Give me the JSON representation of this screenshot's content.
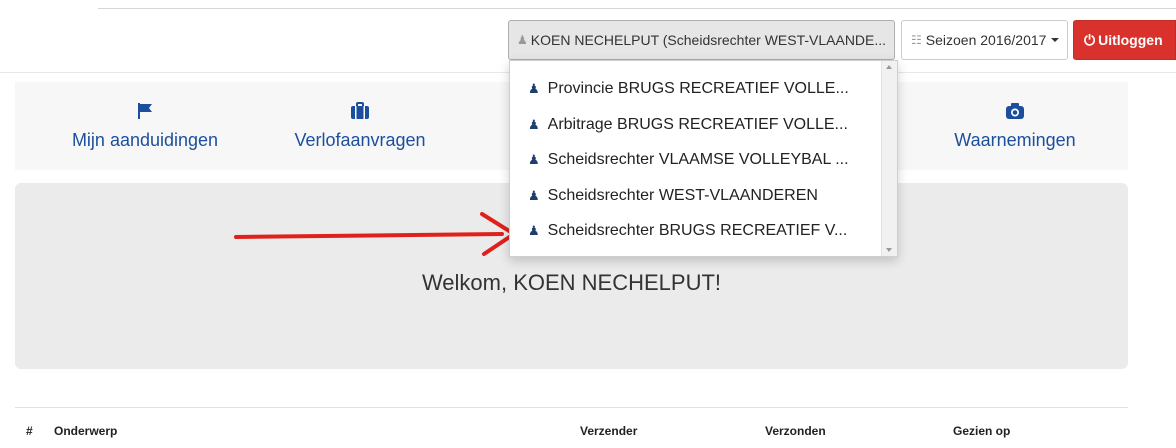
{
  "header": {
    "user_button": "KOEN NECHELPUT (Scheidsrechter WEST-VLAANDE...",
    "season_button": "Seizoen 2016/2017",
    "logout_button": "Uitloggen"
  },
  "nav": [
    {
      "label": "Mijn aanduidingen",
      "icon": "flag-icon"
    },
    {
      "label": "Verlofaanvragen",
      "icon": "briefcase-icon"
    },
    {
      "label": "Waarnemingen",
      "icon": "camera-icon"
    }
  ],
  "dropdown": {
    "items": [
      "Provincie BRUGS RECREATIEF VOLLE...",
      "Arbitrage BRUGS RECREATIEF VOLLE...",
      "Scheidsrechter VLAAMSE VOLLEYBAL ...",
      "Scheidsrechter WEST-VLAANDEREN",
      "Scheidsrechter BRUGS RECREATIEF V..."
    ],
    "item_icon": "user-icon"
  },
  "welcome": {
    "text": "Welkom, KOEN NECHELPUT!"
  },
  "table": {
    "headers": [
      "#",
      "Onderwerp",
      "Verzender",
      "Verzonden",
      "Gezien op"
    ]
  },
  "colors": {
    "accent": "#1b4f9e",
    "logout": "#d9312c",
    "arrow": "#e0201c"
  }
}
